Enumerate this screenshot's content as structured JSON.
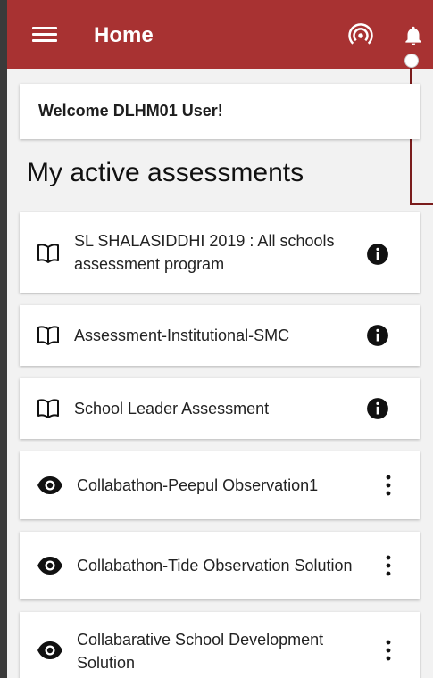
{
  "header": {
    "title": "Home",
    "icons": [
      "menu-icon",
      "broadcast-icon",
      "bell-icon"
    ]
  },
  "welcome": {
    "text": "Welcome DLHM01 User!"
  },
  "section": {
    "heading": "My active assessments"
  },
  "assessments": [
    {
      "label_lines": [
        "SL SHALASIDDHI 2019 : All schools",
        "assessment program"
      ],
      "type_icon": "book-icon",
      "action_icon": "info-icon"
    },
    {
      "label": "Assessment-Institutional-SMC",
      "type_icon": "book-icon",
      "action_icon": "info-icon"
    },
    {
      "label": "School Leader Assessment",
      "type_icon": "book-icon",
      "action_icon": "info-icon"
    }
  ],
  "observations": [
    {
      "label": "Collabathon-Peepul Observation1",
      "type_icon": "eye-icon",
      "action_icon": "more-vert-icon"
    },
    {
      "label": "Collabathon-Tide Observation Solution",
      "type_icon": "eye-icon",
      "action_icon": "more-vert-icon"
    },
    {
      "label_lines": [
        "Collabarative School Development",
        "Solution"
      ],
      "type_icon": "eye-icon",
      "action_icon": "more-vert-icon"
    }
  ],
  "colors": {
    "header": "#a83232",
    "background": "#f2f2f2"
  }
}
